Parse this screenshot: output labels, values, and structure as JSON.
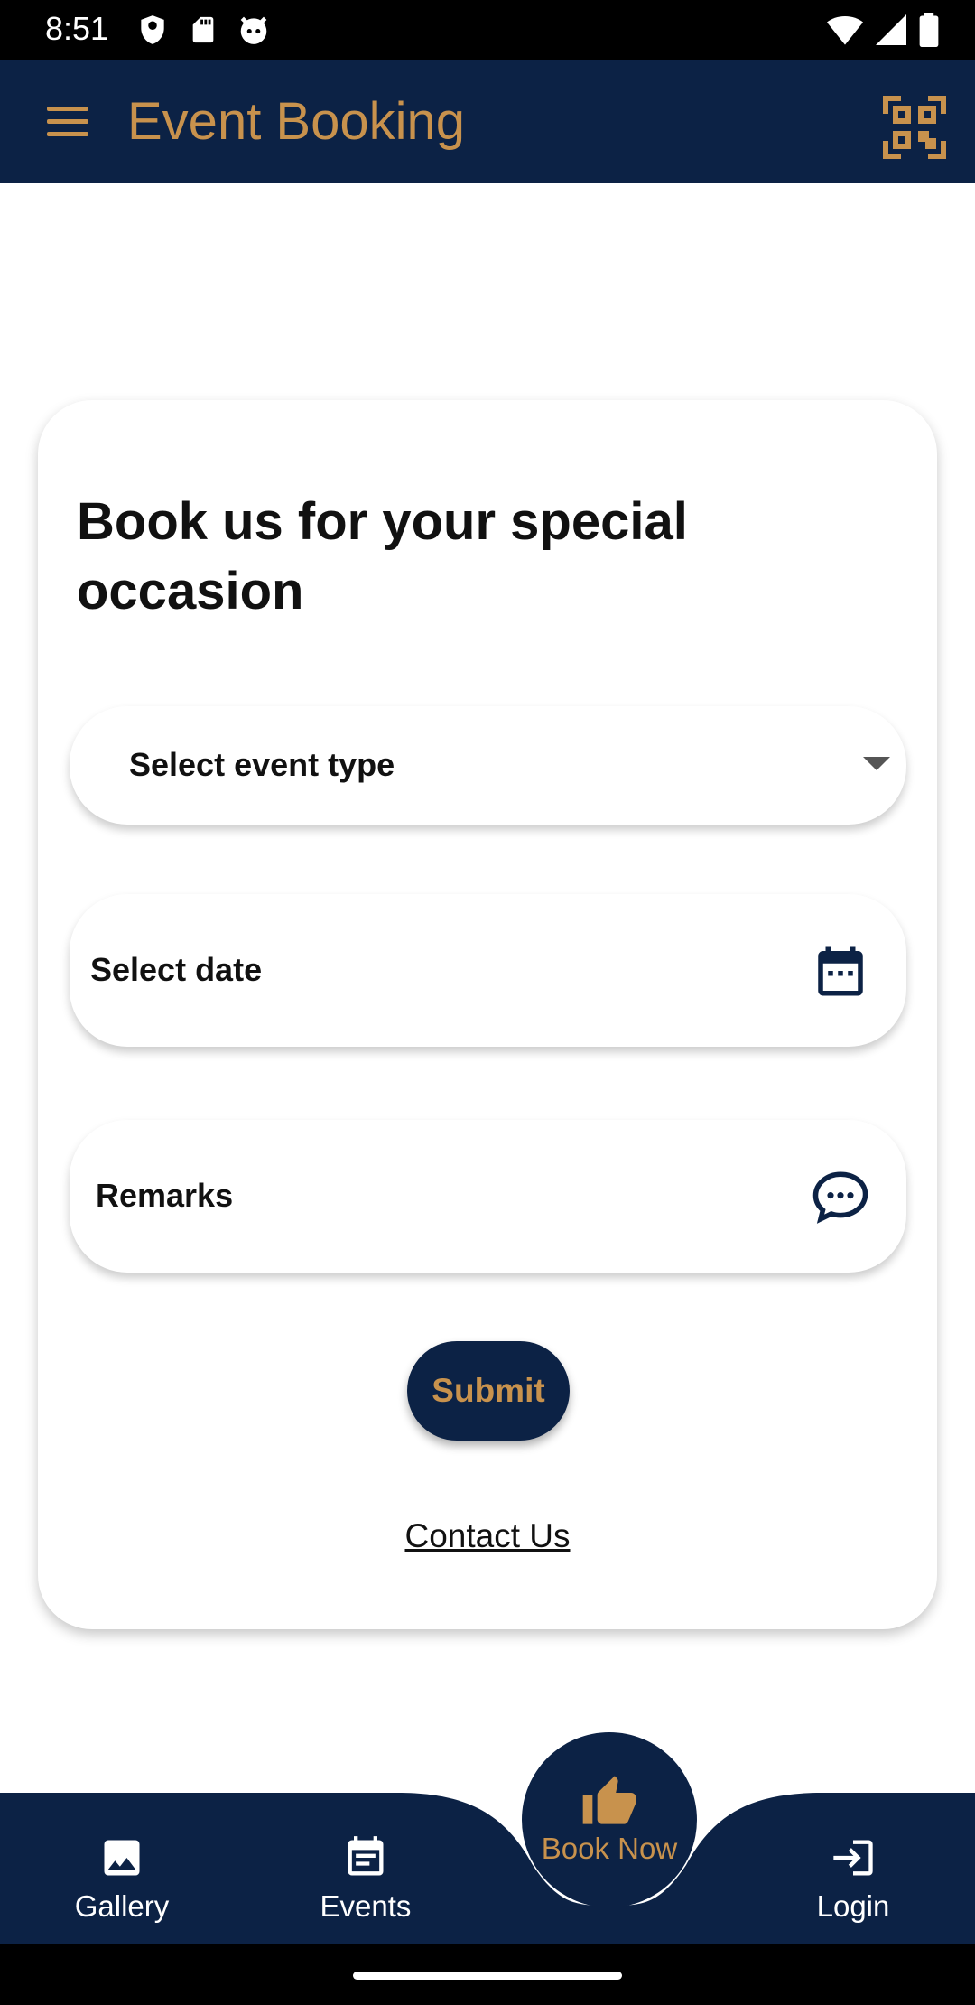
{
  "status_bar": {
    "time": "8:51"
  },
  "app_bar": {
    "title": "Event Booking"
  },
  "form": {
    "heading": "Book us for your special occasion",
    "event_type_placeholder": "Select event type",
    "date_label": "Select date",
    "remarks_label": "Remarks",
    "submit_label": "Submit",
    "contact_link": "Contact Us"
  },
  "bottom_nav": {
    "items": [
      {
        "label": "Gallery",
        "icon": "image-icon"
      },
      {
        "label": "Events",
        "icon": "event-note-icon"
      },
      {
        "label": "Book Now",
        "icon": "thumb-up-icon"
      },
      {
        "label": "Login",
        "icon": "login-icon"
      }
    ]
  },
  "colors": {
    "primary_navy": "#0c2245",
    "accent_gold": "#c8924d"
  }
}
